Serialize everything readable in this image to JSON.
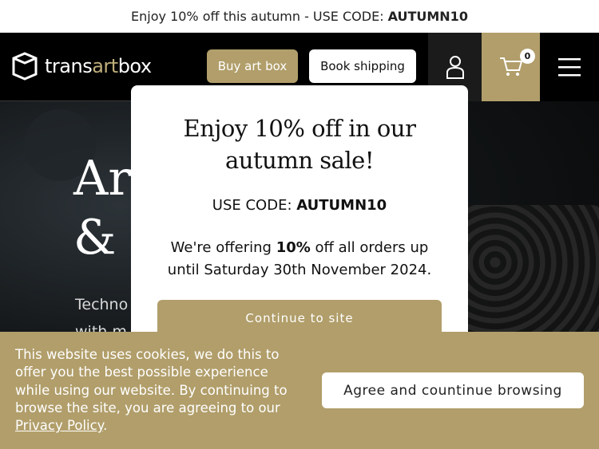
{
  "promo": {
    "text": "Enjoy 10% off this autumn - USE CODE:",
    "code": "AUTUMN10"
  },
  "header": {
    "logo": {
      "part1": "trans",
      "part2": "art",
      "part3": "box"
    },
    "buy_label": "Buy art box",
    "ship_label": "Book shipping",
    "cart_count": "0",
    "icons": {
      "user": "user-icon",
      "cart": "cart-icon",
      "menu": "hamburger-menu-icon",
      "logo": "box-logo-icon"
    }
  },
  "hero": {
    "title_line1": "Art",
    "title_line2": "& F",
    "sub_line1": "Techno",
    "sub_line2": "with m"
  },
  "modal": {
    "title_line1": "Enjoy 10% off in our",
    "title_line2": "autumn sale!",
    "code_prefix": "USE CODE:",
    "code": "AUTUMN10",
    "offer_prefix": "We're offering",
    "offer_pct": "10%",
    "offer_suffix": "off all orders up",
    "offer_line2": "until Saturday 30th November 2024.",
    "continue_label": "Continue to site"
  },
  "cookie": {
    "text": "This website uses cookies, we do this to offer you the best possible experience while using our website. By continuing to browse the site, you are agreeing to our",
    "link": "Privacy Policy",
    "suffix": ".",
    "agree_label": "Agree and countinue browsing"
  },
  "colors": {
    "accent": "#b19e6a",
    "header_bg": "#000000",
    "modal_bg": "#ffffff"
  }
}
